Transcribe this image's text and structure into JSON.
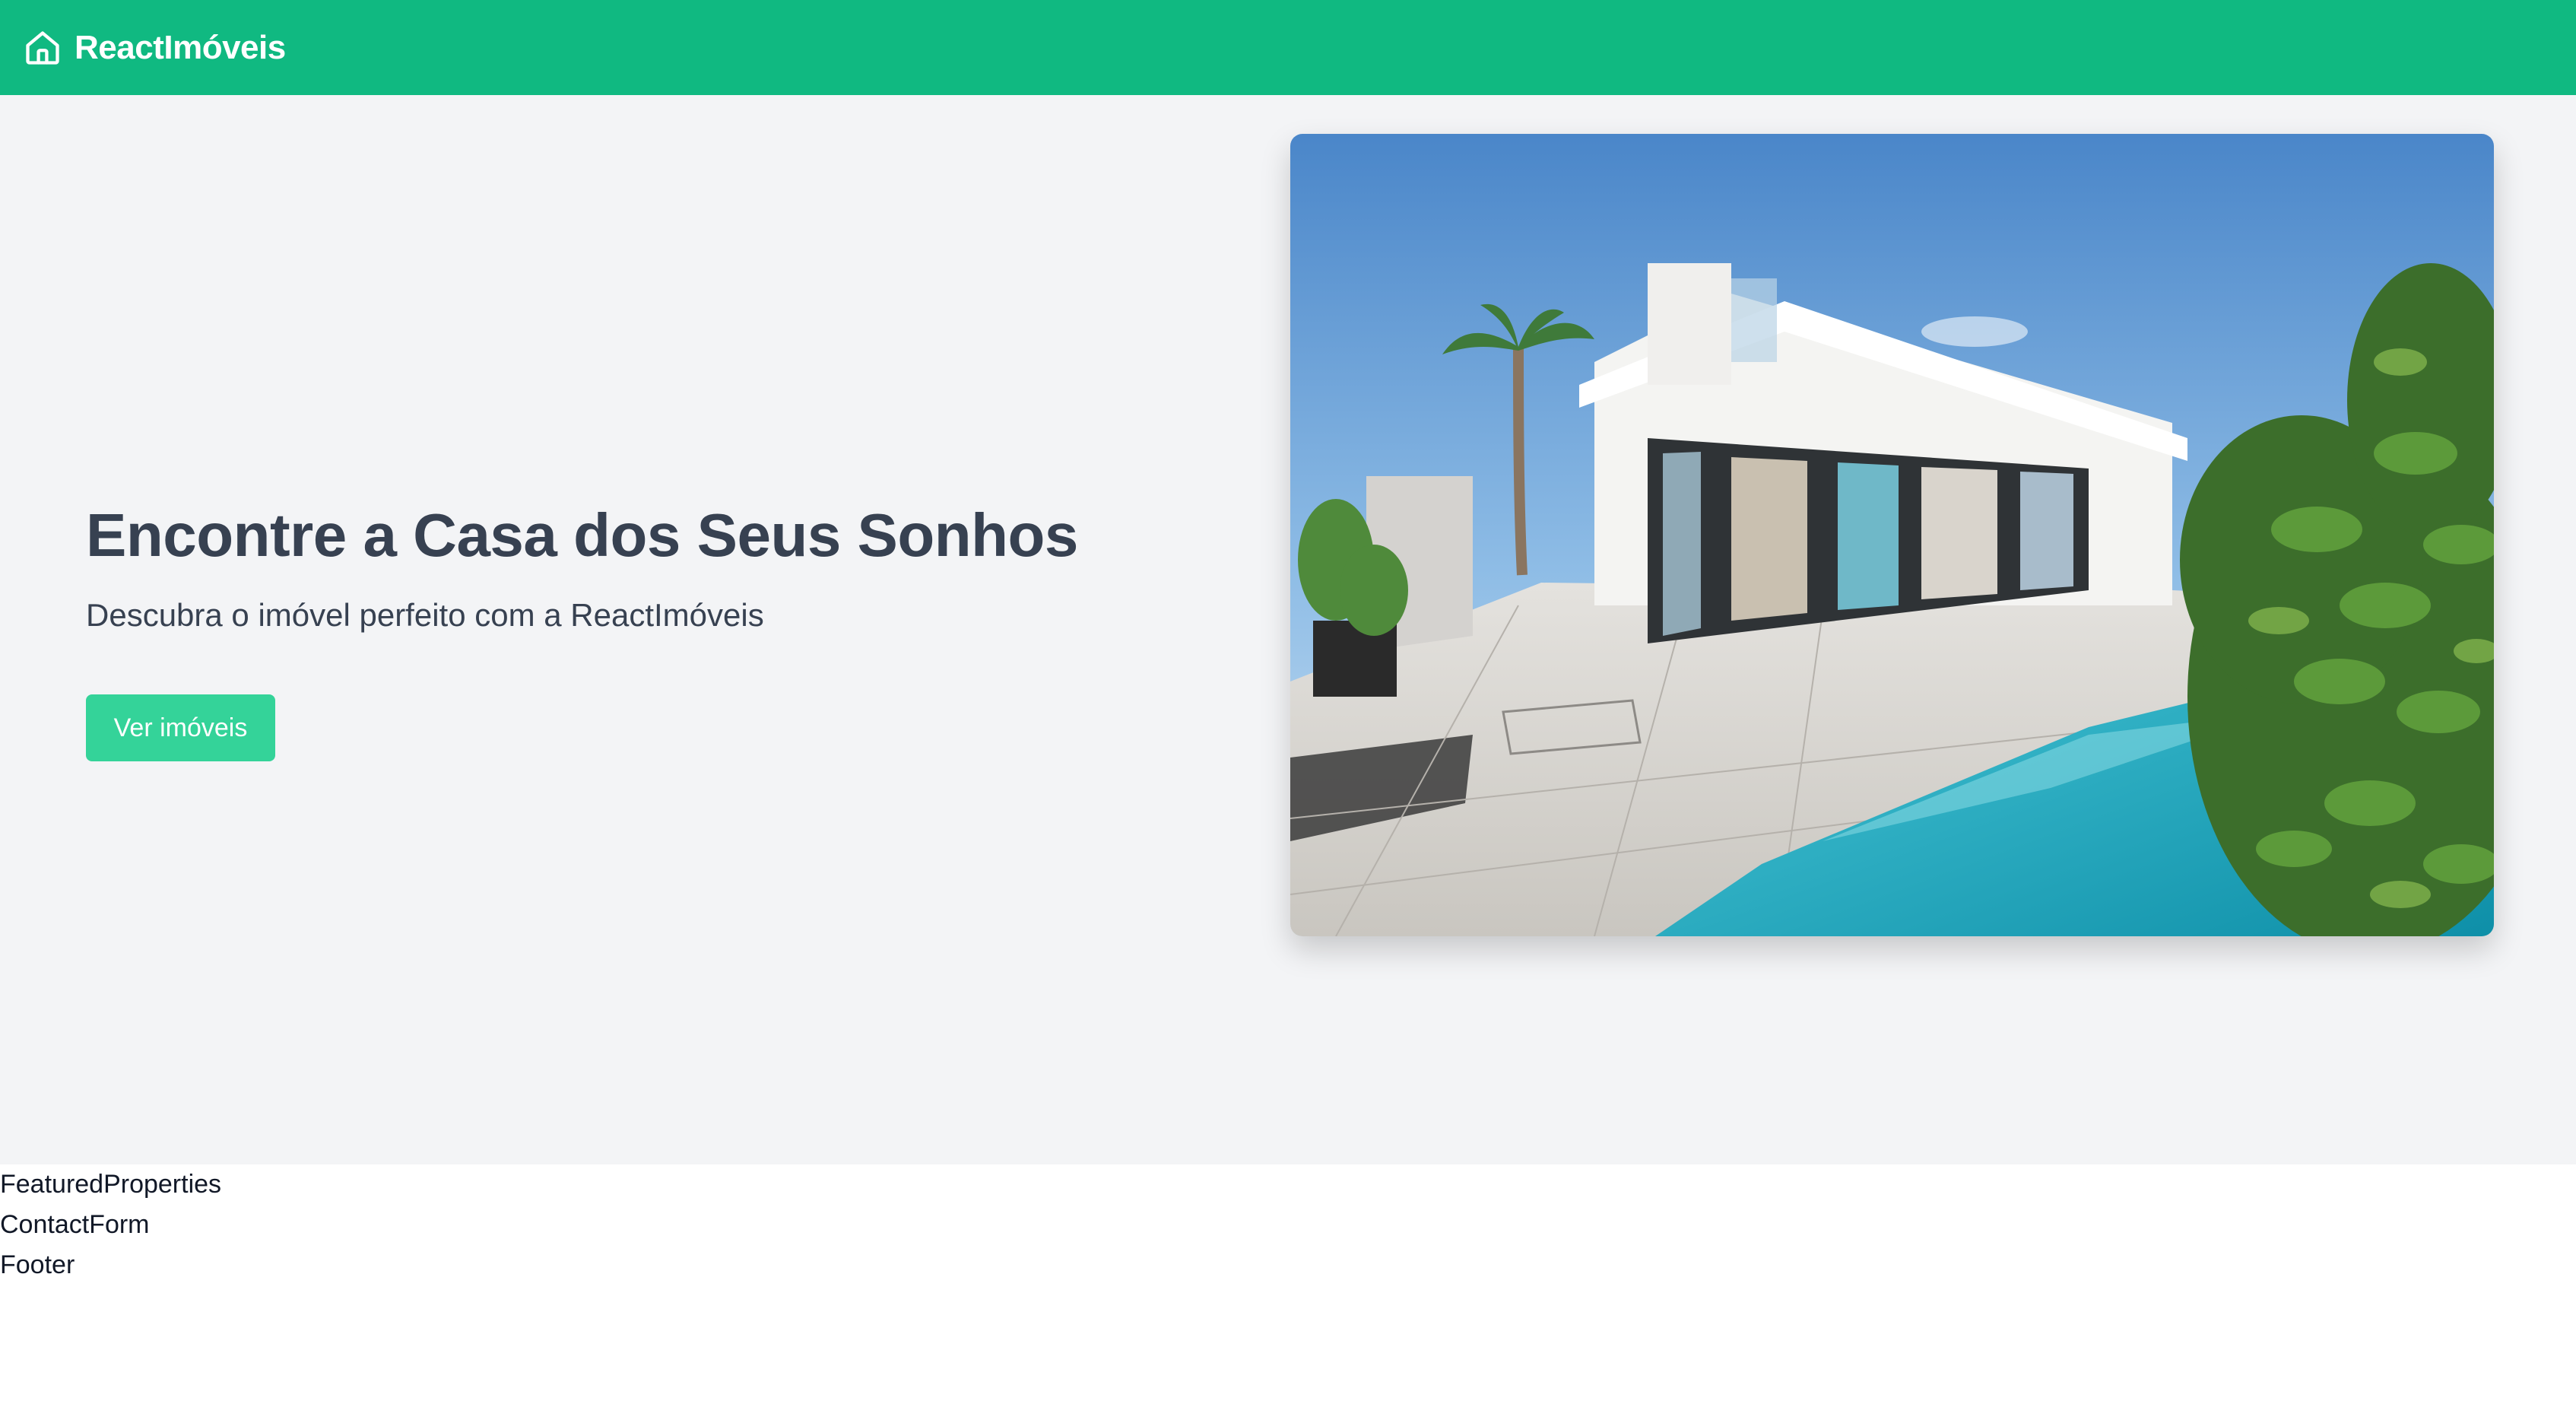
{
  "navbar": {
    "brand_name": "ReactImóveis",
    "brand_icon": "home-icon",
    "background": "#10b981"
  },
  "hero": {
    "title": "Encontre a Casa dos Seus Sonhos",
    "subtitle": "Descubra o imóvel perfeito com a ReactImóveis",
    "cta_label": "Ver imóveis",
    "cta_color": "#34d399",
    "background": "#f3f4f6",
    "image_subject": "modern-white-house-with-pool"
  },
  "placeholders": [
    "FeaturedProperties",
    "ContactForm",
    "Footer"
  ]
}
